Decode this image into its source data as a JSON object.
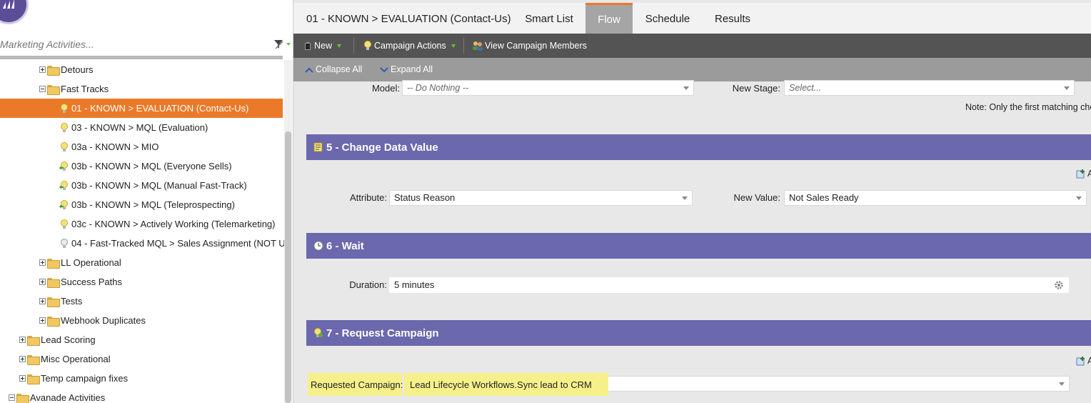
{
  "left_panel": {
    "search_placeholder": "Marketing Activities...",
    "tree": [
      {
        "label": "Detours",
        "type": "folder",
        "expander": "plus",
        "level": 1
      },
      {
        "label": "Fast Tracks",
        "type": "folder",
        "expander": "minus",
        "level": 1
      },
      {
        "label": "01 - KNOWN > EVALUATION (Contact-Us)",
        "type": "campaign",
        "icon": "bulb-yellow-icon",
        "level": 2,
        "selected": true
      },
      {
        "label": "03 - KNOWN > MQL (Evaluation)",
        "type": "campaign",
        "icon": "bulb-yellow-icon",
        "level": 2
      },
      {
        "label": "03a - KNOWN > MIO",
        "type": "campaign",
        "icon": "bulb-yellow-icon",
        "level": 2
      },
      {
        "label": "03b - KNOWN > MQL (Everyone Sells)",
        "type": "campaign",
        "icon": "bulb-green-icon",
        "level": 2
      },
      {
        "label": "03b - KNOWN > MQL (Manual Fast-Track)",
        "type": "campaign",
        "icon": "bulb-green-icon",
        "level": 2
      },
      {
        "label": "03b - KNOWN > MQL (Teleprospecting)",
        "type": "campaign",
        "icon": "bulb-green-icon",
        "level": 2
      },
      {
        "label": "03c - KNOWN > Actively Working (Telemarketing)",
        "type": "campaign",
        "icon": "bulb-yellow-icon",
        "level": 2
      },
      {
        "label": "04 - Fast-Tracked MQL > Sales Assignment (NOT US",
        "type": "campaign",
        "icon": "bulb-gray-icon",
        "level": 2
      },
      {
        "label": "LL Operational",
        "type": "folder",
        "expander": "plus",
        "level": 1
      },
      {
        "label": "Success Paths",
        "type": "folder",
        "expander": "plus",
        "level": 1
      },
      {
        "label": "Tests",
        "type": "folder",
        "expander": "plus",
        "level": 1
      },
      {
        "label": "Webhook Duplicates",
        "type": "folder",
        "expander": "plus",
        "level": 1
      },
      {
        "label": "Lead Scoring",
        "type": "folder",
        "expander": "plus",
        "level": 0
      },
      {
        "label": "Misc Operational",
        "type": "folder",
        "expander": "plus",
        "level": 0
      },
      {
        "label": "Temp campaign fixes",
        "type": "folder",
        "expander": "plus",
        "level": 0
      },
      {
        "label": "Avanade Activities",
        "type": "folder",
        "expander": "minus",
        "level": -1
      }
    ]
  },
  "header": {
    "campaign_title": "01 - KNOWN > EVALUATION (Contact-Us)",
    "tabs": [
      {
        "label": "Smart List",
        "active": false
      },
      {
        "label": "Flow",
        "active": true
      },
      {
        "label": "Schedule",
        "active": false
      },
      {
        "label": "Results",
        "active": false
      }
    ]
  },
  "toolbar": {
    "new_label": "New",
    "campaign_actions_label": "Campaign Actions",
    "view_members_label": "View Campaign Members"
  },
  "subtoolbar": {
    "collapse_all": "Collapse All",
    "expand_all": "Expand All"
  },
  "flow": {
    "step4_partial": {
      "model_label": "Model:",
      "model_value": "-- Do Nothing --",
      "new_stage_label": "New Stage:",
      "new_stage_value": "Select...",
      "note": "Note: Only the first matching cho"
    },
    "step5": {
      "title": "5 - Change Data Value",
      "attribute_label": "Attribute:",
      "attribute_value": "Status Reason",
      "new_value_label": "New Value:",
      "new_value_value": "Not Sales Ready",
      "add_label": "A"
    },
    "step6": {
      "title": "6 - Wait",
      "duration_label": "Duration:",
      "duration_value": "5 minutes"
    },
    "step7": {
      "title": "7 - Request Campaign",
      "requested_label": "Requested Campaign:",
      "requested_value": "Lead Lifecycle Workflows.Sync lead to CRM",
      "add_label": "A"
    }
  },
  "colors": {
    "brand_purple": "#5c4d99",
    "step_header": "#6c68ad",
    "selected_orange": "#ea7a2a",
    "highlight_yellow": "#f6f08a"
  }
}
